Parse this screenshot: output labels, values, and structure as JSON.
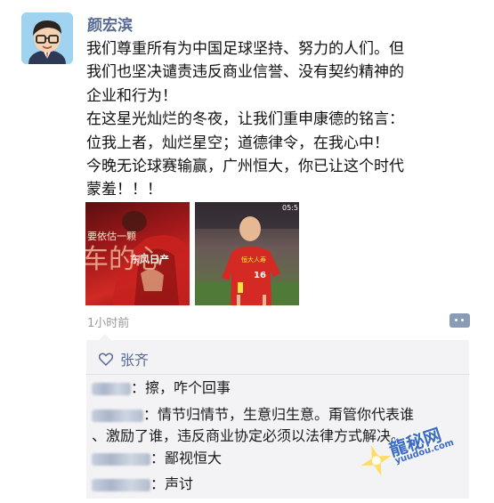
{
  "post": {
    "author": "颜宏滨",
    "lines": [
      "我们尊重所有为中国足球坚持、努力的人们。但",
      "我们也坚决谴责违反商业信誉、没有契约精神的",
      "企业和行为！",
      "在这星光灿烂的冬夜，让我们重申康德的铭言：",
      "位我上者，灿烂星空；道德律令，在我心中！",
      "今晚无论球赛输赢，广州恒大，你已让这个时代",
      "蒙羞！！！"
    ],
    "photos": [
      {
        "overlay_texts": [
          "要依估一颗",
          "东风日产",
          "车的心"
        ]
      },
      {
        "timer": "05:5",
        "jersey_sponsor": "恒大人寿",
        "jersey_number": "16"
      }
    ],
    "time": "1小时前"
  },
  "likes": {
    "names": "张齐"
  },
  "comments": [
    {
      "author": "",
      "text": "：擦，咋个回事"
    },
    {
      "author": "",
      "text": "：情节归情节，生意归生意。甭管你代表谁",
      "text_continued": "、激励了谁，违反商业协定必须以法律方式解决。"
    },
    {
      "author": "",
      "text": "：鄙视恒大"
    },
    {
      "author": "",
      "text": "：声讨"
    }
  ],
  "watermark": {
    "text": "龍秘网",
    "url": "yuudou.com"
  },
  "icons": {
    "like": "heart-outline-icon",
    "more": "more-dots-icon"
  },
  "colors": {
    "link_blue": "#576b95",
    "comment_bg": "#f3f3f5",
    "muted": "#9a9a9a"
  }
}
